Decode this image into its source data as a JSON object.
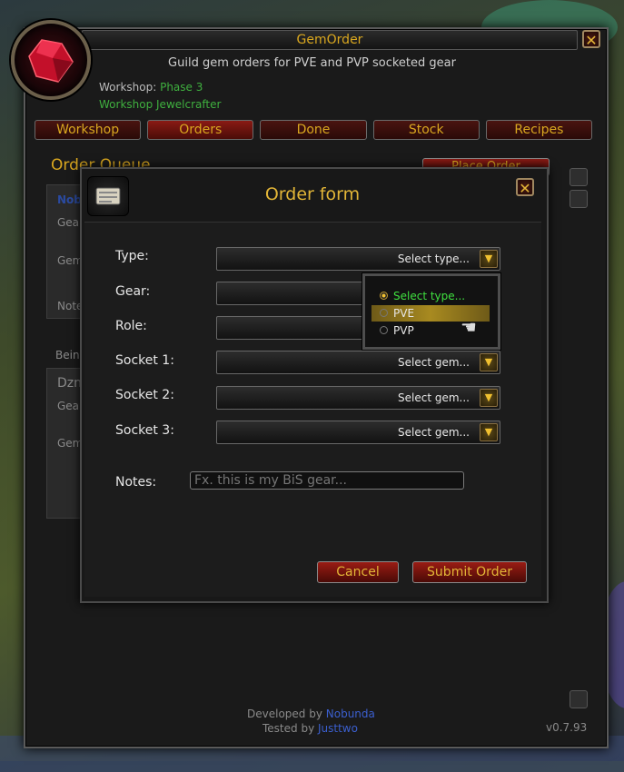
{
  "app": {
    "title": "GemOrder",
    "subtitle": "Guild gem orders for PVE and PVP socketed gear",
    "workshop_label": "Workshop:",
    "workshop_value": "Phase 3",
    "role": "Workshop Jewelcrafter"
  },
  "tabs": [
    {
      "label": "Workshop",
      "active": false
    },
    {
      "label": "Orders",
      "active": true
    },
    {
      "label": "Done",
      "active": false
    },
    {
      "label": "Stock",
      "active": false
    },
    {
      "label": "Recipes",
      "active": false
    }
  ],
  "queue": {
    "title": "Order Queue",
    "place_order": "Place Order",
    "card1": {
      "name": "Nob",
      "gear": "Gea",
      "gem": "Gem",
      "notes": "Note"
    },
    "section2": "Bein",
    "card2": {
      "name": "Dzn",
      "gear": "Gea",
      "gem": "Gem"
    }
  },
  "footer": {
    "developed_prefix": "Developed by",
    "developer": "Nobunda",
    "tested_prefix": "Tested by",
    "tester": "Justtwo",
    "version": "v0.7.93"
  },
  "order_form": {
    "title": "Order form",
    "fields": [
      {
        "label": "Type:",
        "value": "Select type..."
      },
      {
        "label": "Gear:",
        "value": ""
      },
      {
        "label": "Role:",
        "value": ""
      },
      {
        "label": "Socket 1:",
        "value": "Select gem..."
      },
      {
        "label": "Socket 2:",
        "value": "Select gem..."
      },
      {
        "label": "Socket 3:",
        "value": "Select gem..."
      }
    ],
    "notes_label": "Notes:",
    "notes_placeholder": "Fx. this is my BiS gear...",
    "cancel": "Cancel",
    "submit": "Submit Order",
    "type_options": [
      {
        "label": "Select type...",
        "selected": true
      },
      {
        "label": "PVE",
        "hover": true
      },
      {
        "label": "PVP"
      }
    ]
  },
  "colors": {
    "gold": "#e2b537",
    "green": "#3fb03f",
    "button_red": "#9a1c14"
  }
}
